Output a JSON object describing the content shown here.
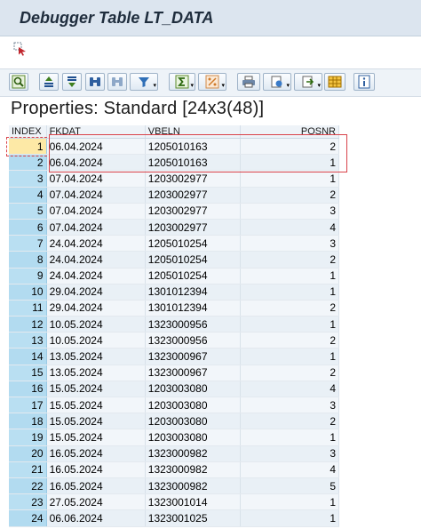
{
  "window": {
    "title": "Debugger Table LT_DATA"
  },
  "toolbar": {
    "buttons": [
      {
        "name": "details-button",
        "icon": "magnifier-icon"
      },
      {
        "name": "sort-ascending-button",
        "icon": "sort-ascending-icon"
      },
      {
        "name": "sort-descending-button",
        "icon": "sort-descending-icon"
      },
      {
        "name": "find-button",
        "icon": "binoculars-icon"
      },
      {
        "name": "find-next-button",
        "icon": "binoculars-next-icon"
      },
      {
        "name": "filter-button",
        "icon": "filter-icon"
      },
      {
        "name": "total-button",
        "icon": "sigma-icon"
      },
      {
        "name": "subtotal-button",
        "icon": "subtotal-icon"
      },
      {
        "name": "print-button",
        "icon": "printer-icon"
      },
      {
        "name": "views-button",
        "icon": "views-icon"
      },
      {
        "name": "export-button",
        "icon": "export-icon"
      },
      {
        "name": "layout-button",
        "icon": "grid-layout-icon"
      },
      {
        "name": "info-button",
        "icon": "info-icon"
      }
    ]
  },
  "subtitle": "Properties: Standard [24x3(48)]",
  "table": {
    "columns": [
      "INDEX",
      "FKDAT",
      "VBELN",
      "POSNR"
    ],
    "rows": [
      [
        "1",
        "06.04.2024",
        "1205010163",
        "2"
      ],
      [
        "2",
        "06.04.2024",
        "1205010163",
        "1"
      ],
      [
        "3",
        "07.04.2024",
        "1203002977",
        "1"
      ],
      [
        "4",
        "07.04.2024",
        "1203002977",
        "2"
      ],
      [
        "5",
        "07.04.2024",
        "1203002977",
        "3"
      ],
      [
        "6",
        "07.04.2024",
        "1203002977",
        "4"
      ],
      [
        "7",
        "24.04.2024",
        "1205010254",
        "3"
      ],
      [
        "8",
        "24.04.2024",
        "1205010254",
        "2"
      ],
      [
        "9",
        "24.04.2024",
        "1205010254",
        "1"
      ],
      [
        "10",
        "29.04.2024",
        "1301012394",
        "1"
      ],
      [
        "11",
        "29.04.2024",
        "1301012394",
        "2"
      ],
      [
        "12",
        "10.05.2024",
        "1323000956",
        "1"
      ],
      [
        "13",
        "10.05.2024",
        "1323000956",
        "2"
      ],
      [
        "14",
        "13.05.2024",
        "1323000967",
        "1"
      ],
      [
        "15",
        "13.05.2024",
        "1323000967",
        "2"
      ],
      [
        "16",
        "15.05.2024",
        "1203003080",
        "4"
      ],
      [
        "17",
        "15.05.2024",
        "1203003080",
        "3"
      ],
      [
        "18",
        "15.05.2024",
        "1203003080",
        "2"
      ],
      [
        "19",
        "15.05.2024",
        "1203003080",
        "1"
      ],
      [
        "20",
        "16.05.2024",
        "1323000982",
        "3"
      ],
      [
        "21",
        "16.05.2024",
        "1323000982",
        "4"
      ],
      [
        "22",
        "16.05.2024",
        "1323000982",
        "5"
      ],
      [
        "23",
        "27.05.2024",
        "1323001014",
        "1"
      ],
      [
        "24",
        "06.06.2024",
        "1323001025",
        "1"
      ]
    ]
  }
}
